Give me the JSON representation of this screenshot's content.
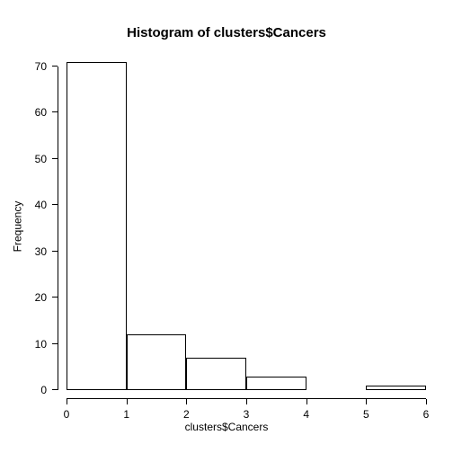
{
  "chart_data": {
    "type": "bar",
    "title": "Histogram of clusters$Cancers",
    "xlabel": "clusters$Cancers",
    "ylabel": "Frequency",
    "xlim": [
      0,
      6
    ],
    "ylim": [
      0,
      70
    ],
    "x_ticks": [
      0,
      1,
      2,
      3,
      4,
      5,
      6
    ],
    "y_ticks": [
      0,
      10,
      20,
      30,
      40,
      50,
      60,
      70
    ],
    "bins": [
      {
        "x0": 0,
        "x1": 1,
        "count": 71
      },
      {
        "x0": 1,
        "x1": 2,
        "count": 12
      },
      {
        "x0": 2,
        "x1": 3,
        "count": 7
      },
      {
        "x0": 3,
        "x1": 4,
        "count": 3
      },
      {
        "x0": 4,
        "x1": 5,
        "count": 0
      },
      {
        "x0": 5,
        "x1": 6,
        "count": 1
      }
    ]
  }
}
